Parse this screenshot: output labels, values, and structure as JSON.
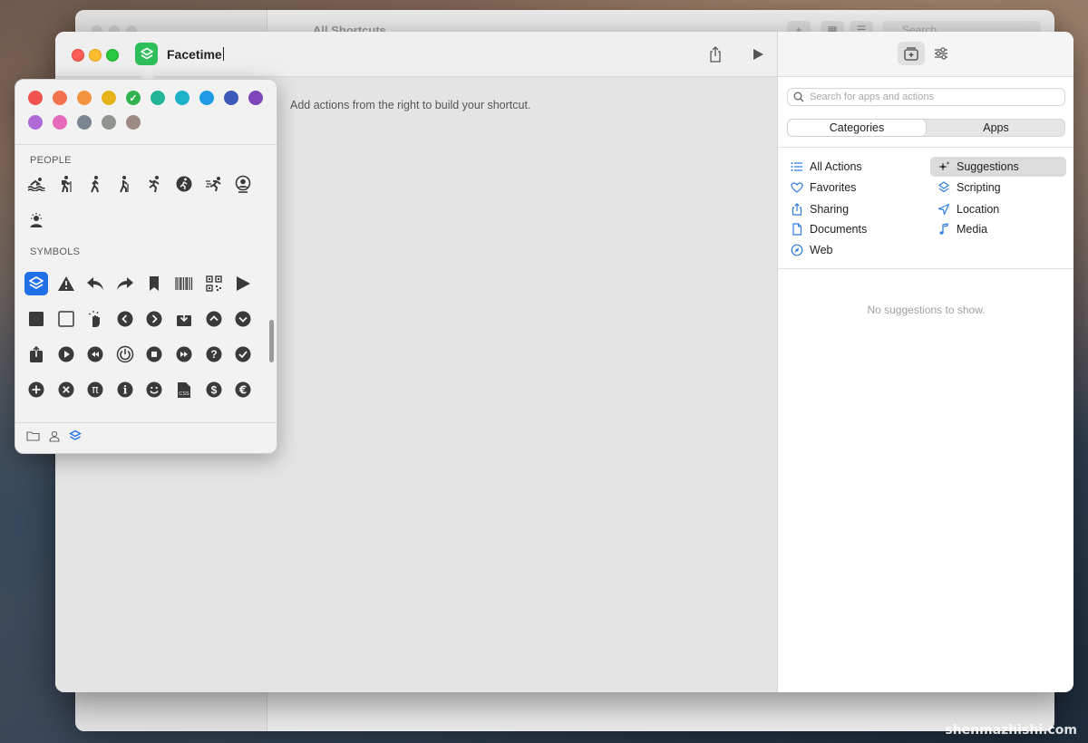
{
  "background_window": {
    "title": "All Shortcuts",
    "search_placeholder": "Search"
  },
  "editor": {
    "shortcut_name": "Facetime",
    "hint": "Add actions from the right to build your shortcut.",
    "icon_color": "#2fbf5a"
  },
  "right_pane": {
    "search_placeholder": "Search for apps and actions",
    "segments": [
      "Categories",
      "Apps"
    ],
    "selected_segment": "Categories",
    "categories_left": [
      {
        "label": "All Actions",
        "icon": "list-icon"
      },
      {
        "label": "Favorites",
        "icon": "heart-icon"
      },
      {
        "label": "Sharing",
        "icon": "share-icon"
      },
      {
        "label": "Documents",
        "icon": "document-icon"
      },
      {
        "label": "Web",
        "icon": "compass-icon"
      }
    ],
    "categories_right": [
      {
        "label": "Suggestions",
        "icon": "sparkle-icon",
        "selected": true
      },
      {
        "label": "Scripting",
        "icon": "scripting-icon"
      },
      {
        "label": "Location",
        "icon": "location-arrow-icon"
      },
      {
        "label": "Media",
        "icon": "music-note-icon"
      }
    ],
    "empty_message": "No suggestions to show."
  },
  "popover": {
    "colors": [
      "#ef5350",
      "#f2714f",
      "#f2933f",
      "#e9b21b",
      "#30b24e",
      "#22b59a",
      "#1eb2c9",
      "#1f9be8",
      "#3d59b8",
      "#7d47ba",
      "#b06ad8",
      "#e66aba",
      "#7b8591",
      "#8f958e",
      "#9e8a84"
    ],
    "selected_color_index": 4,
    "people_label": "PEOPLE",
    "people_icons": [
      "swimmer-icon",
      "hiker-icon",
      "walker-icon",
      "cane-walker-icon",
      "runner-icon",
      "runner-circle-icon",
      "sprinter-icon",
      "person-circle-icon",
      "person-sun-icon"
    ],
    "symbols_label": "SYMBOLS",
    "symbol_icons": [
      "shortcuts-icon",
      "warning-icon",
      "reply-arrow-icon",
      "forward-arrow-icon",
      "bookmark-icon",
      "barcode-icon",
      "qrcode-icon",
      "play-triangle-icon",
      "filled-square-icon",
      "empty-square-icon",
      "hand-tap-icon",
      "chevron-left-circle-icon",
      "chevron-right-circle-icon",
      "download-tray-icon",
      "chevron-up-circle-icon",
      "chevron-down-circle-icon",
      "upload-tray-icon",
      "play-circle-icon",
      "rewind-circle-icon",
      "power-circle-icon",
      "stop-circle-icon",
      "fast-forward-circle-icon",
      "question-circle-icon",
      "checkmark-circle-icon",
      "plus-circle-icon",
      "x-circle-icon",
      "pi-circle-icon",
      "info-circle-icon",
      "smiley-icon",
      "css-document-icon",
      "dollar-circle-icon",
      "euro-circle-icon"
    ],
    "selected_symbol_index": 0,
    "footer_tabs": [
      "folder-icon",
      "person-icon",
      "shortcuts-icon"
    ],
    "active_footer_tab": 2,
    "people_glyphs": [
      "≈",
      "⛏",
      "🚶",
      "⟟",
      "🏃",
      "●",
      "⇶",
      "◉",
      "☀"
    ]
  },
  "watermark": "shenmazhishi.com"
}
